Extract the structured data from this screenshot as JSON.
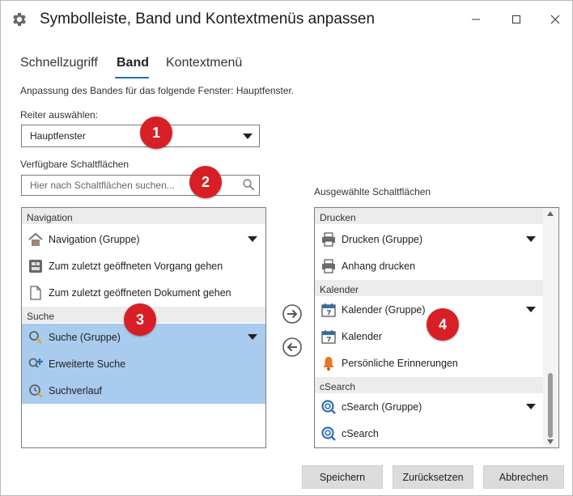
{
  "window": {
    "title": "Symbolleiste, Band und Kontextmenüs anpassen",
    "icon": "gear-icon",
    "controls": [
      "minimize-icon",
      "maximize-icon",
      "close-icon"
    ]
  },
  "tabs": [
    {
      "label": "Schnellzugriff",
      "active": false
    },
    {
      "label": "Band",
      "active": true
    },
    {
      "label": "Kontextmenü",
      "active": false
    }
  ],
  "description": "Anpassung des Bandes für das folgende Fenster: Hauptfenster.",
  "tab_select": {
    "label": "Reiter auswählen:",
    "value": "Hauptfenster"
  },
  "available": {
    "label": "Verfügbare Schaltflächen",
    "search_placeholder": "Hier nach Schaltflächen suchen...",
    "groups": [
      {
        "name": "Navigation",
        "items": [
          {
            "label": "Navigation (Gruppe)",
            "icon": "navigation-home-icon",
            "expandable": true,
            "selected": false
          },
          {
            "label": "Zum zuletzt geöffneten Vorgang gehen",
            "icon": "recent-process-icon",
            "expandable": false,
            "selected": false
          },
          {
            "label": "Zum zuletzt geöffneten Dokument gehen",
            "icon": "document-icon",
            "expandable": false,
            "selected": false
          }
        ]
      },
      {
        "name": "Suche",
        "items": [
          {
            "label": "Suche (Gruppe)",
            "icon": "search-icon",
            "expandable": true,
            "selected": true
          },
          {
            "label": "Erweiterte Suche",
            "icon": "advanced-search-icon",
            "expandable": false,
            "selected": true
          },
          {
            "label": "Suchverlauf",
            "icon": "search-history-icon",
            "expandable": false,
            "selected": true
          }
        ]
      }
    ]
  },
  "selected": {
    "label": "Ausgewählte Schaltflächen",
    "groups": [
      {
        "name": "Drucken",
        "items": [
          {
            "label": "Drucken (Gruppe)",
            "icon": "printer-icon",
            "expandable": true
          },
          {
            "label": "Anhang drucken",
            "icon": "printer-icon",
            "expandable": false
          }
        ]
      },
      {
        "name": "Kalender",
        "items": [
          {
            "label": "Kalender (Gruppe)",
            "icon": "calendar-icon",
            "expandable": true
          },
          {
            "label": "Kalender",
            "icon": "calendar-icon",
            "expandable": false
          },
          {
            "label": "Persönliche Erinnerungen",
            "icon": "bell-icon",
            "expandable": false
          }
        ]
      },
      {
        "name": "cSearch",
        "items": [
          {
            "label": "cSearch (Gruppe)",
            "icon": "csearch-icon",
            "expandable": true
          },
          {
            "label": "cSearch",
            "icon": "csearch-icon",
            "expandable": false
          }
        ]
      }
    ]
  },
  "badges": [
    "1",
    "2",
    "3",
    "4"
  ],
  "buttons": {
    "save": "Speichern",
    "reset": "Zurücksetzen",
    "cancel": "Abbrechen"
  },
  "colors": {
    "accent": "#1e6fc4",
    "selection": "#a9cbee",
    "badge": "#d81f26",
    "group_header": "#ececec"
  }
}
